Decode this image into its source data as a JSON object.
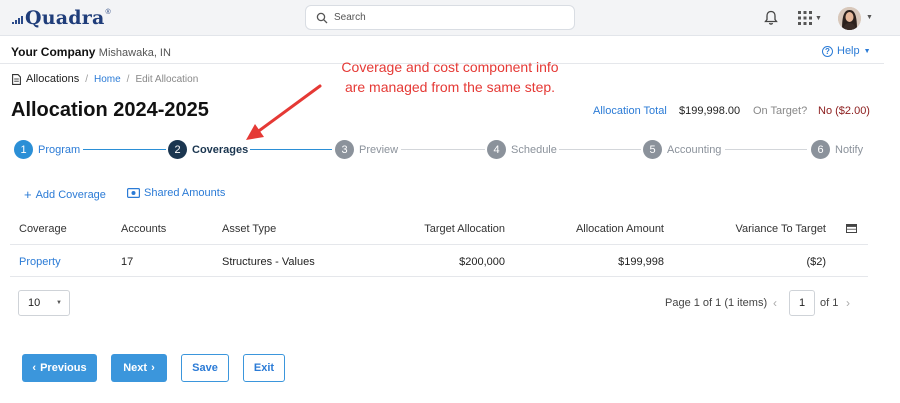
{
  "app": {
    "logo_text": "Quadra",
    "logo_mark": "®"
  },
  "search": {
    "placeholder": "Search"
  },
  "header": {
    "company": "Your Company",
    "location": "Mishawaka, IN",
    "help_label": "Help"
  },
  "breadcrumb": {
    "root": "Allocations",
    "home": "Home",
    "current": "Edit Allocation"
  },
  "page": {
    "title": "Allocation 2024-2025",
    "allocation_total_label": "Allocation Total",
    "allocation_total_value": "$199,998.00",
    "on_target_label": "On Target?",
    "on_target_value": "No ($2.00)"
  },
  "stepper": [
    {
      "num": "1",
      "label": "Program",
      "state": "done"
    },
    {
      "num": "2",
      "label": "Coverages",
      "state": "active"
    },
    {
      "num": "3",
      "label": "Preview",
      "state": "todo"
    },
    {
      "num": "4",
      "label": "Schedule",
      "state": "todo"
    },
    {
      "num": "5",
      "label": "Accounting",
      "state": "todo"
    },
    {
      "num": "6",
      "label": "Notify",
      "state": "todo"
    }
  ],
  "annotation": {
    "line1": "Coverage and cost component info",
    "line2": "are managed from the same step."
  },
  "actions": {
    "add_coverage": "Add Coverage",
    "shared_amounts": "Shared Amounts"
  },
  "table": {
    "columns": [
      "Coverage",
      "Accounts",
      "Asset Type",
      "Target Allocation",
      "Allocation Amount",
      "Variance To Target"
    ],
    "rows": [
      [
        "Property",
        "17",
        "Structures - Values",
        "$200,000",
        "$199,998",
        "($2)"
      ]
    ]
  },
  "pager": {
    "page_size": "10",
    "info": "Page 1 of 1 (1 items)",
    "current_page": "1",
    "of_label": "of",
    "total_pages": "1"
  },
  "buttons": {
    "previous": "Previous",
    "next": "Next",
    "save": "Save",
    "exit": "Exit"
  },
  "colors": {
    "accent": "#2b7bd6",
    "active_step": "#1b3650",
    "annotation": "#e53935",
    "negative": "#8b1c1c"
  }
}
